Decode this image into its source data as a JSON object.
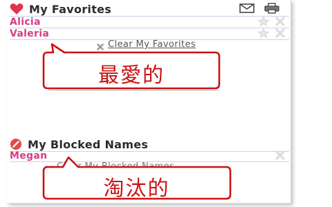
{
  "favorites": {
    "title": "My Favorites",
    "icon": "heart-icon",
    "tools": [
      "mail-icon",
      "print-icon"
    ],
    "items": [
      {
        "name": "Alicia"
      },
      {
        "name": "Valeria"
      }
    ],
    "clear_label": "Clear My Favorites"
  },
  "blocked": {
    "title": "My Blocked Names",
    "icon": "block-icon",
    "items": [
      {
        "name": "Megan"
      }
    ],
    "clear_label": "Clear My Blocked Names"
  },
  "callouts": {
    "favorites_note": "最愛的",
    "blocked_note": "淘汰的"
  },
  "colors": {
    "name": "#d63c86",
    "callout_border": "#cc1111",
    "callout_text": "#cc1111",
    "heart": "#e0344f"
  }
}
